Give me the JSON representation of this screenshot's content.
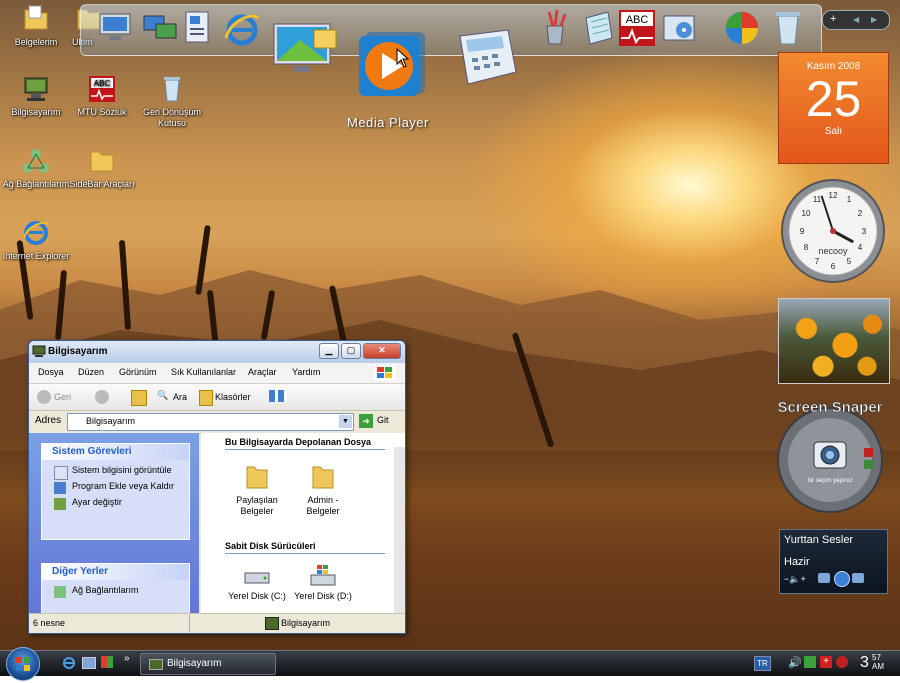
{
  "desktop": {
    "icons": [
      {
        "label": "Belgelerim",
        "icon": "folder-icon"
      },
      {
        "label": "Ultim",
        "icon": "folder-icon"
      },
      {
        "label": "Bilgisayarım",
        "icon": "computer-icon"
      },
      {
        "label": "MTU Sözlük",
        "icon": "abc-icon"
      },
      {
        "label": "Geri Dönüşüm Kutusu",
        "icon": "recycle-bin-icon"
      },
      {
        "label": "Ağ Bağlantılarım",
        "icon": "network-icon"
      },
      {
        "label": "SideBar Araçları",
        "icon": "folder-icon"
      },
      {
        "label": "Internet Explorer",
        "icon": "internet-explorer-icon"
      }
    ]
  },
  "dock": {
    "hover_label": "Media Player",
    "controls": {
      "add": "+",
      "prev": "◀",
      "next": "▶"
    }
  },
  "calendar": {
    "month": "Kasım 2008",
    "day": "25",
    "weekday": "Salı"
  },
  "clock_gadget": {
    "brand": "necooy",
    "hour": 3,
    "minute": 57
  },
  "screen_snaper": {
    "title": "Screen Snaper",
    "subtitle": "bir seçim yapınız"
  },
  "radio": {
    "title": "Yurttan Sesler",
    "status": "Hazir"
  },
  "window": {
    "title": "Bilgisayarım",
    "menu": [
      "Dosya",
      "Düzen",
      "Görünüm",
      "Sık Kullanılanlar",
      "Araçlar",
      "Yardım"
    ],
    "toolbar": {
      "back": "Geri",
      "search": "Ara",
      "folders": "Klasörler"
    },
    "address": {
      "label": "Adres",
      "value": "Bilgisayarım",
      "go": "Git"
    },
    "left_panels": [
      {
        "title": "Sistem Görevleri",
        "items": [
          "Sistem bilgisini görüntüle",
          "Program Ekle veya Kaldır",
          "Ayar değiştir"
        ]
      },
      {
        "title": "Diğer Yerler",
        "items": [
          "Ağ Bağlantılarım"
        ]
      }
    ],
    "sections": [
      {
        "title": "Bu Bilgisayarda Depolanan Dosya",
        "items": [
          "Paylaşılan Belgeler",
          "Admin - Belgeler"
        ]
      },
      {
        "title": "Sabit Disk Sürücüleri",
        "items": [
          "Yerel Disk (C:)",
          "Yerel Disk (D:)"
        ]
      }
    ],
    "status": {
      "count": "6 nesne",
      "location": "Bilgisayarım"
    }
  },
  "taskbar": {
    "task": "Bilgisayarım",
    "language": "TR",
    "time_hour": "3",
    "time_min": "57",
    "time_suffix": "AM"
  }
}
